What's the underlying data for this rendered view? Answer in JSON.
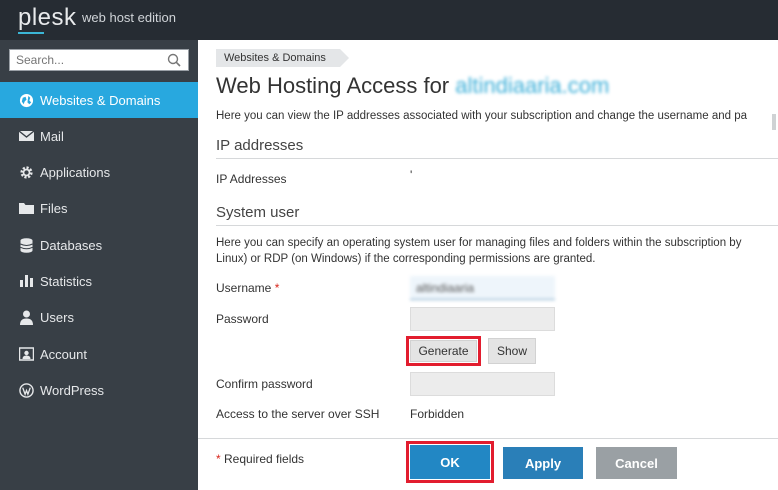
{
  "header": {
    "logo": "plesk",
    "edition": "web host edition"
  },
  "sidebar": {
    "search_placeholder": "Search...",
    "items": [
      {
        "label": "Websites & Domains",
        "icon": "globe-icon",
        "active": true
      },
      {
        "label": "Mail",
        "icon": "envelope-icon"
      },
      {
        "label": "Applications",
        "icon": "gear-icon"
      },
      {
        "label": "Files",
        "icon": "folder-icon"
      },
      {
        "label": "Databases",
        "icon": "database-icon"
      },
      {
        "label": "Statistics",
        "icon": "bar-chart-icon"
      },
      {
        "label": "Users",
        "icon": "user-icon"
      },
      {
        "label": "Account",
        "icon": "account-card-icon"
      },
      {
        "label": "WordPress",
        "icon": "wordpress-icon"
      }
    ]
  },
  "main": {
    "breadcrumb": "Websites & Domains",
    "title_prefix": "Web Hosting Access for",
    "title_domain": "altindiaaria.com",
    "intro": "Here you can view the IP addresses associated with your subscription and change the username and pa",
    "ip_section": {
      "title": "IP addresses",
      "label": "IP Addresses",
      "value": "'"
    },
    "system_user_section": {
      "title": "System user",
      "description_line1": "Here you can specify an operating system user for managing files and folders within the subscription by",
      "description_line2": "Linux) or RDP (on Windows) if the corresponding permissions are granted.",
      "username_label": "Username",
      "required_mark": "*",
      "username_value": "altindiaaria",
      "password_label": "Password",
      "generate_label": "Generate",
      "show_label": "Show",
      "confirm_label": "Confirm password",
      "ssh_label": "Access to the server over SSH",
      "ssh_value": "Forbidden"
    },
    "footer": {
      "required_mark": "*",
      "required_note": "Required fields",
      "ok_label": "OK",
      "apply_label": "Apply",
      "cancel_label": "Cancel"
    }
  },
  "colors": {
    "topbar": "#262c33",
    "sidebar": "#383f46",
    "active": "#28a8df",
    "primary_button": "#2287c4",
    "cancel_button": "#9aa0a4",
    "highlight": "#e21d2e"
  }
}
